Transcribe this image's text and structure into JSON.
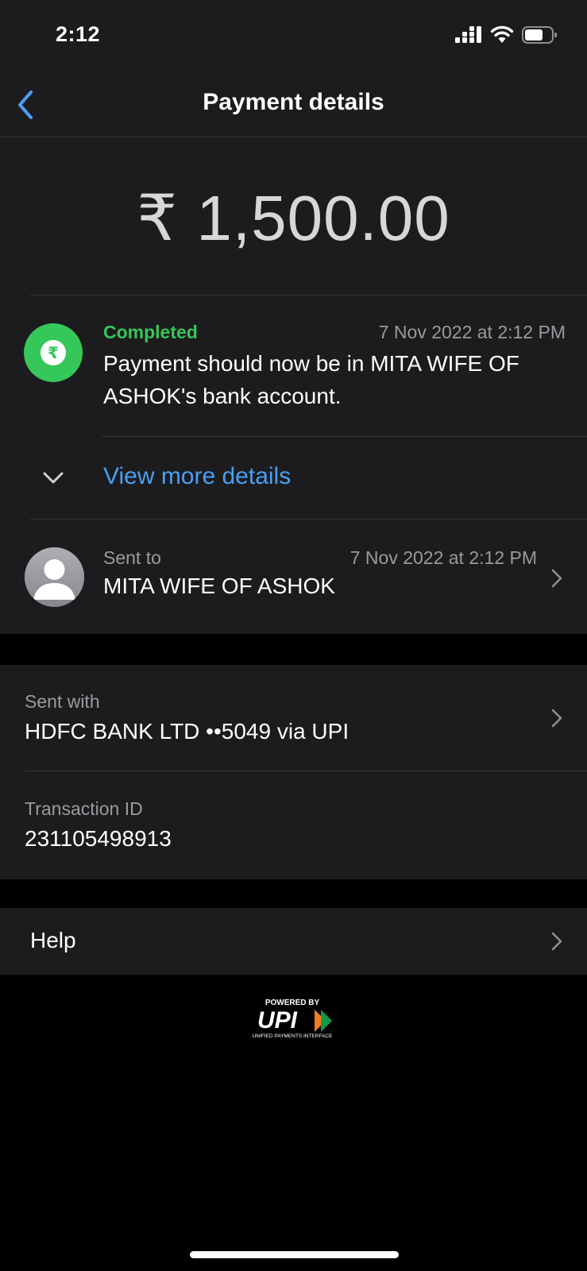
{
  "status_bar": {
    "time": "2:12"
  },
  "nav": {
    "title": "Payment details",
    "back_icon": "chevron-left-icon"
  },
  "colors": {
    "accent_blue": "#4a9ff5",
    "success_green": "#35c759",
    "background": "#1c1c1e"
  },
  "amount": "₹ 1,500.00",
  "status": {
    "icon": "rupee-icon",
    "label": "Completed",
    "date": "7 Nov 2022 at 2:12 PM",
    "message": "Payment should now be in MITA WIFE OF ASHOK's bank account."
  },
  "view_more": {
    "label": "View more details",
    "icon": "chevron-down-icon"
  },
  "recipient": {
    "label": "Sent to",
    "date": "7 Nov 2022 at 2:12 PM",
    "name": "MITA WIFE OF ASHOK",
    "icon": "person-avatar-icon"
  },
  "payment_method": {
    "label": "Sent with",
    "value": "HDFC BANK LTD ••5049 via UPI"
  },
  "transaction": {
    "label": "Transaction ID",
    "value": "231105498913"
  },
  "help": {
    "label": "Help"
  },
  "footer": {
    "powered_by": "POWERED BY",
    "brand": "UPI",
    "tagline": "UNIFIED PAYMENTS INTERFACE"
  }
}
